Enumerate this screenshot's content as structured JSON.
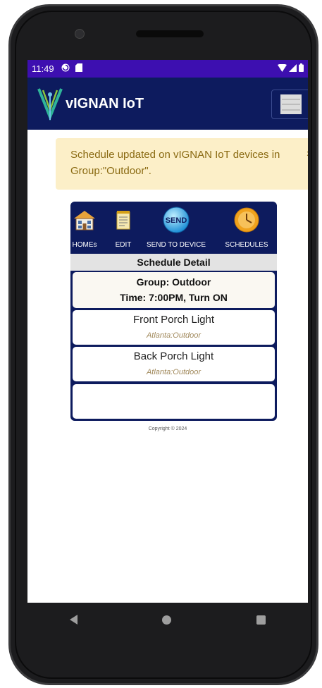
{
  "status": {
    "time": "11:49"
  },
  "app": {
    "title": "vIGNAN IoT"
  },
  "alert": {
    "message": "Schedule updated on vIGNAN IoT devices in Group:\"Outdoor\".",
    "close": "x"
  },
  "toolbar": {
    "items": [
      {
        "label": "HOMEs",
        "icon": "house-icon"
      },
      {
        "label": "EDIT",
        "icon": "edit-notepad-icon"
      },
      {
        "label": "SEND TO DEVICE",
        "icon": "send-icon",
        "icon_text": "SEND"
      },
      {
        "label": "SCHEDULES",
        "icon": "clock-icon"
      }
    ]
  },
  "schedule": {
    "header": "Schedule Detail",
    "group": "Group: Outdoor",
    "time": "Time: 7:00PM, Turn ON",
    "devices": [
      {
        "name": "Front Porch Light",
        "location": "Atlanta:Outdoor"
      },
      {
        "name": "Back Porch Light",
        "location": "Atlanta:Outdoor"
      }
    ]
  },
  "footer": {
    "copyright": "Copyright © 2024"
  },
  "colors": {
    "status_bar": "#3d0fb0",
    "app_bar": "#0d1b5e",
    "alert_bg": "#fcefc8",
    "alert_text": "#8a6a12"
  }
}
